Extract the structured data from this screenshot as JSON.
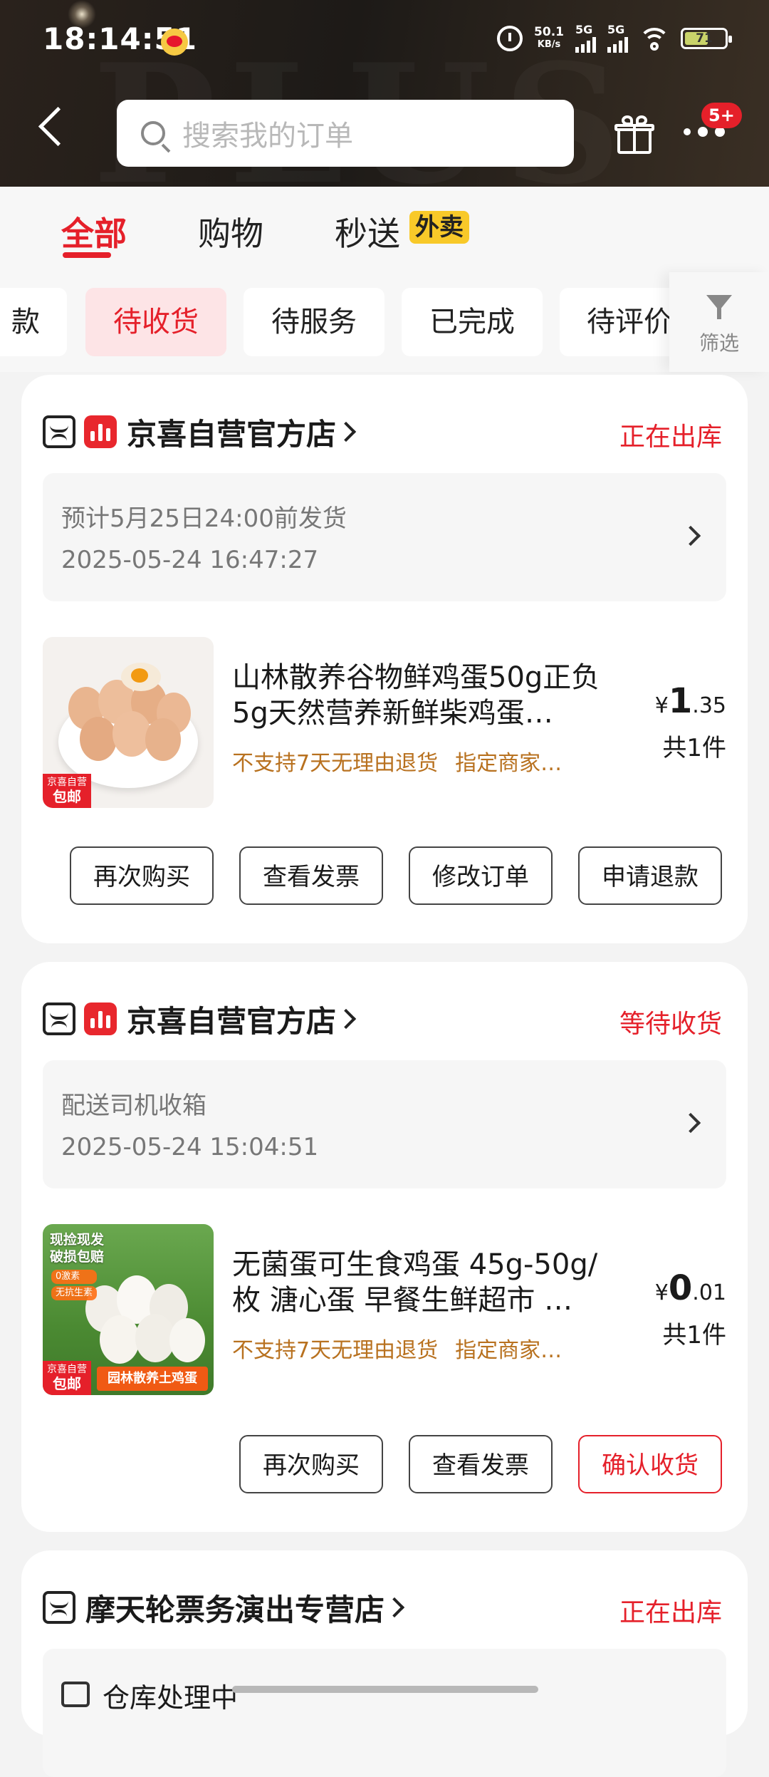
{
  "status_bar": {
    "time": "18:14:51",
    "net_speed_value": "50.1",
    "net_speed_unit": "KB/s",
    "signal1": "5G",
    "signal2": "5G",
    "battery": "71"
  },
  "header": {
    "watermark": "PLUS",
    "search_placeholder": "搜索我的订单",
    "badge": "5+"
  },
  "main_tabs": [
    {
      "label": "全部",
      "active": true
    },
    {
      "label": "购物",
      "active": false
    },
    {
      "label": "秒送",
      "active": false,
      "tag": "外卖"
    }
  ],
  "filter_chips": [
    {
      "label": "款"
    },
    {
      "label": "待收货",
      "active": true
    },
    {
      "label": "待服务"
    },
    {
      "label": "已完成"
    },
    {
      "label": "待评价"
    }
  ],
  "filter_label": "筛选",
  "orders": [
    {
      "store": "京喜自营官方店",
      "status": "正在出库",
      "info_line1": "预计5月25日24:00前发货",
      "info_line2": "2025-05-24 16:47:27",
      "product_title": "山林散养谷物鲜鸡蛋50g正负5g天然营养新鲜柴鸡蛋…",
      "tags": [
        "不支持7天无理由退货",
        "指定商家…"
      ],
      "badge_top": "京喜自营",
      "badge_bottom": "包邮",
      "price_symbol": "¥",
      "price_int": "1",
      "price_dec": ".35",
      "qty": "共1件",
      "buttons": [
        "再次购买",
        "查看发票",
        "修改订单",
        "申请退款"
      ]
    },
    {
      "store": "京喜自营官方店",
      "status": "等待收货",
      "info_line1": "配送司机收箱",
      "info_line2": "2025-05-24 15:04:51",
      "product_title": "无菌蛋可生食鸡蛋 45g-50g/枚 溏心蛋 早餐生鲜超市 …",
      "tags": [
        "不支持7天无理由退货",
        "指定商家…"
      ],
      "badge_top": "京喜自营",
      "badge_bottom": "包邮",
      "img_text1": "现捡现发",
      "img_text2": "破损包赔",
      "img_text3": "0激素",
      "img_text4": "无抗生素",
      "img_banner": "园林散养土鸡蛋",
      "price_symbol": "¥",
      "price_int": "0",
      "price_dec": ".01",
      "qty": "共1件",
      "buttons": [
        "再次购买",
        "查看发票",
        "确认收货"
      ]
    },
    {
      "store": "摩天轮票务演出专营店",
      "status": "正在出库",
      "info_line1": "仓库处理中"
    }
  ],
  "colors": {
    "accent": "#e5202a",
    "tag_text": "#b8711f",
    "header_bg": "#1d1a17"
  }
}
